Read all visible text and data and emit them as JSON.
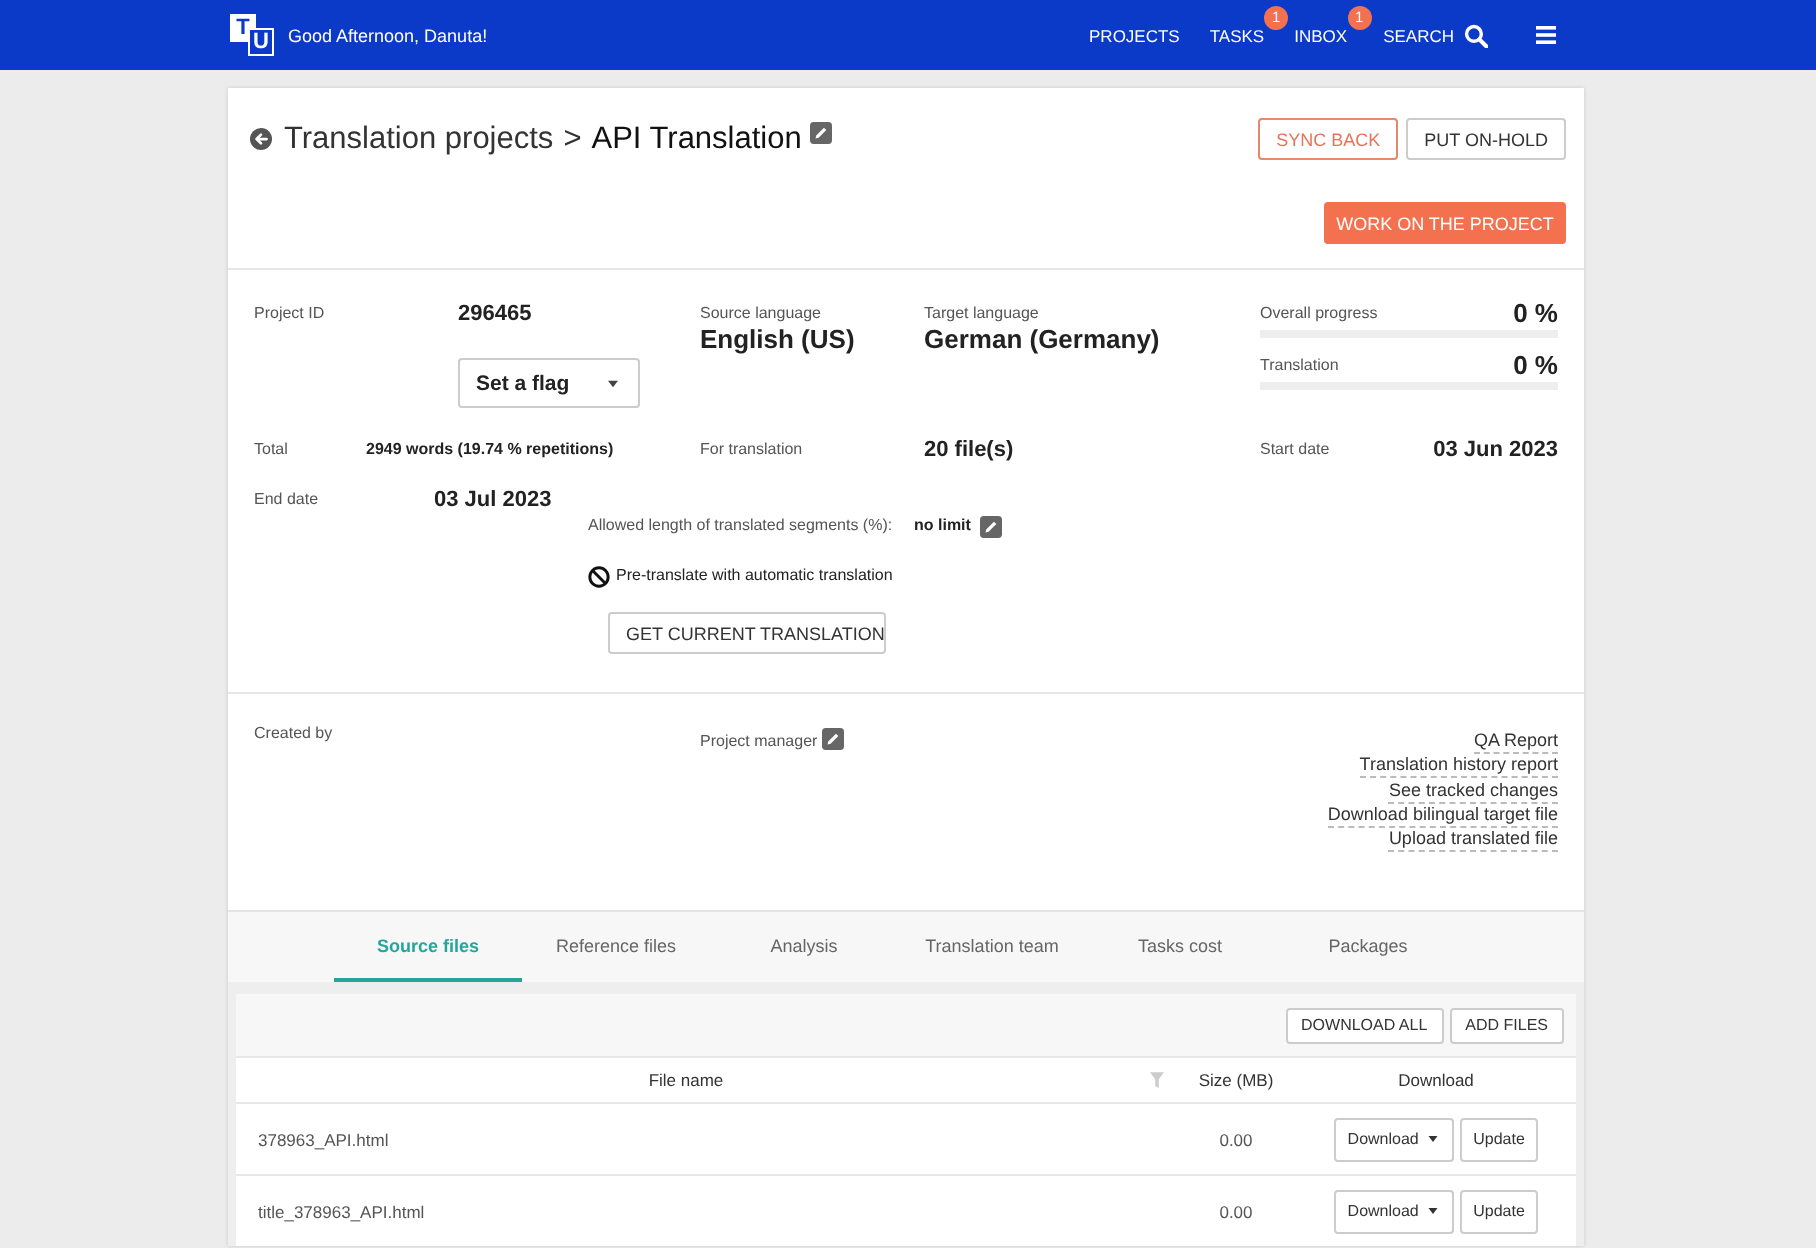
{
  "topbar": {
    "logo_letters": [
      "T",
      "U"
    ],
    "greeting": "Good Afternoon, Danuta!",
    "nav": [
      {
        "label": "PROJECTS",
        "kind": "link"
      },
      {
        "label": "TASKS",
        "kind": "link",
        "badge": "1"
      },
      {
        "label": "INBOX",
        "kind": "link",
        "badge": "1"
      },
      {
        "label": "SEARCH",
        "kind": "search"
      }
    ]
  },
  "header": {
    "breadcrumb": "Translation projects",
    "separator": ">",
    "title": "API Translation",
    "actions": [
      {
        "label": "SYNC BACK",
        "kind": "accent"
      },
      {
        "label": "PUT ON-HOLD",
        "kind": "plain"
      }
    ],
    "primary_action": "WORK ON THE PROJECT"
  },
  "details": {
    "project_id": {
      "label": "Project ID",
      "value": "296465"
    },
    "flag_dropdown": {
      "value": "Set a flag"
    },
    "source_language": {
      "label": "Source language",
      "value": "English (US)"
    },
    "target_language": {
      "label": "Target language",
      "value": "German (Germany)"
    },
    "progress": [
      {
        "label": "Overall progress",
        "reading": "0 %",
        "level": 0
      },
      {
        "label": "Translation",
        "reading": "0 %",
        "level": 0
      }
    ],
    "total": {
      "label": "Total",
      "value": "2949 words (19.74 % repetitions)"
    },
    "for_translation": {
      "label": "For translation",
      "value": "20 file(s)"
    },
    "start_date": {
      "label": "Start date",
      "value": "03 Jun 2023"
    },
    "end_date": {
      "label": "End date",
      "value": "03 Jul 2023"
    },
    "allowed_length": {
      "label": "Allowed length of translated segments (%):",
      "value": "no limit"
    },
    "pre_translate": {
      "label": "Pre-translate with automatic translation",
      "enabled": false
    },
    "get_translation_button": "GET CURRENT TRANSLATION"
  },
  "people": {
    "created_by": "Created by",
    "project_manager": "Project manager"
  },
  "reports": [
    "QA Report",
    "Translation history report",
    "See tracked changes",
    "Download bilingual target file",
    "Upload translated file"
  ],
  "tabs": [
    {
      "label": "Source files",
      "selected": true
    },
    {
      "label": "Reference files",
      "selected": false
    },
    {
      "label": "Analysis",
      "selected": false
    },
    {
      "label": "Translation team",
      "selected": false
    },
    {
      "label": "Tasks cost",
      "selected": false
    },
    {
      "label": "Packages",
      "selected": false
    }
  ],
  "files": {
    "actions": [
      "DOWNLOAD ALL",
      "ADD FILES"
    ],
    "columns": [
      "File name",
      "Size (MB)",
      "Download"
    ],
    "rows": [
      {
        "name": "378963_API.html",
        "size": "0.00",
        "download": "Download",
        "update": "Update"
      },
      {
        "name": "title_378963_API.html",
        "size": "0.00",
        "download": "Download",
        "update": "Update"
      }
    ]
  }
}
